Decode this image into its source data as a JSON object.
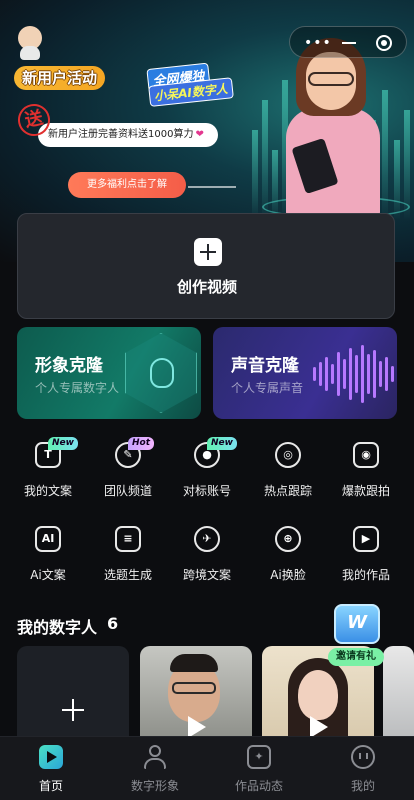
{
  "hero": {
    "new_user_tag": "新用户活动",
    "promo_line1": "全网爆独",
    "promo_line2": "小呆AI数字人",
    "stamp": "送",
    "bubble_text": "新用户注册完善资料送1000算力",
    "more_button": "更多福利点击了解"
  },
  "create": {
    "label": "创作视频"
  },
  "clones": [
    {
      "title": "形象克隆",
      "subtitle": "个人专属数字人"
    },
    {
      "title": "声音克隆",
      "subtitle": "个人专属声音"
    }
  ],
  "features_row1": [
    {
      "label": "我的文案",
      "badge": "New",
      "icon": "text-icon"
    },
    {
      "label": "团队频道",
      "badge": "Hot",
      "icon": "pen-icon"
    },
    {
      "label": "对标账号",
      "badge": "New",
      "icon": "user-icon"
    },
    {
      "label": "热点跟踪",
      "badge": "",
      "icon": "target-icon"
    },
    {
      "label": "爆款跟拍",
      "badge": "",
      "icon": "camera-icon"
    }
  ],
  "features_row2": [
    {
      "label": "Ai文案",
      "icon": "ai-icon"
    },
    {
      "label": "选题生成",
      "icon": "topic-icon"
    },
    {
      "label": "跨境文案",
      "icon": "plane-icon"
    },
    {
      "label": "Ai换脸",
      "icon": "globe-icon"
    },
    {
      "label": "我的作品",
      "icon": "video-icon"
    }
  ],
  "my_humans": {
    "title": "我的数字人",
    "count": "6",
    "invite_label": "邀请有礼",
    "invite_glyph": "W"
  },
  "tabs": [
    {
      "label": "首页",
      "active": true
    },
    {
      "label": "数字形象",
      "active": false
    },
    {
      "label": "作品动态",
      "active": false
    },
    {
      "label": "我的",
      "active": false
    }
  ]
}
